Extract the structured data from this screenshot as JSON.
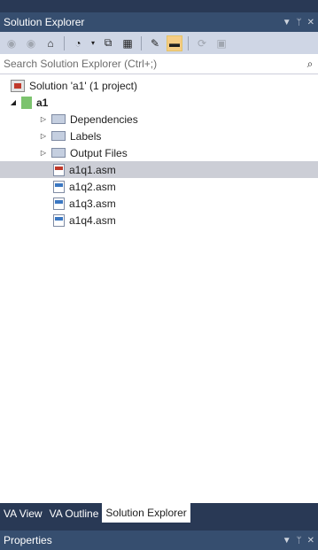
{
  "solution_explorer": {
    "title": "Solution Explorer",
    "header_icons": [
      "dropdown-icon",
      "pin-icon",
      "close-icon"
    ]
  },
  "toolbar": {
    "buttons": [
      {
        "name": "back-icon",
        "glyph": "◀"
      },
      {
        "name": "forward-icon",
        "glyph": "▶"
      },
      {
        "name": "home-icon",
        "glyph": "⌂"
      },
      {
        "name": "pending-changes-icon",
        "glyph": "◔▾"
      },
      {
        "name": "collapse-all-icon",
        "glyph": "▣"
      },
      {
        "name": "show-all-files-icon",
        "glyph": "⧉"
      },
      {
        "name": "properties-wrench-icon",
        "glyph": "🔧"
      },
      {
        "name": "preview-selected-icon",
        "glyph": "▬"
      },
      {
        "name": "sync-icon",
        "glyph": "⟳"
      },
      {
        "name": "view-code-icon",
        "glyph": "▶"
      }
    ]
  },
  "search": {
    "placeholder": "Search Solution Explorer (Ctrl+;)"
  },
  "tree": {
    "solution_label": "Solution 'a1' (1 project)",
    "project_label": "a1",
    "folders": [
      "Dependencies",
      "Labels",
      "Output Files"
    ],
    "files": [
      "a1q1.asm",
      "a1q2.asm",
      "a1q3.asm",
      "a1q4.asm"
    ]
  },
  "bottom_tabs": {
    "va_view": "VA View",
    "va_outline": "VA Outline",
    "solution_explorer": "Solution Explorer"
  },
  "properties": {
    "title": "Properties"
  },
  "colors": {
    "header_bg": "#364e6f",
    "toolbar_bg": "#cfd6e5",
    "selected_row": "#ccced6",
    "frame_bg": "#293955"
  }
}
